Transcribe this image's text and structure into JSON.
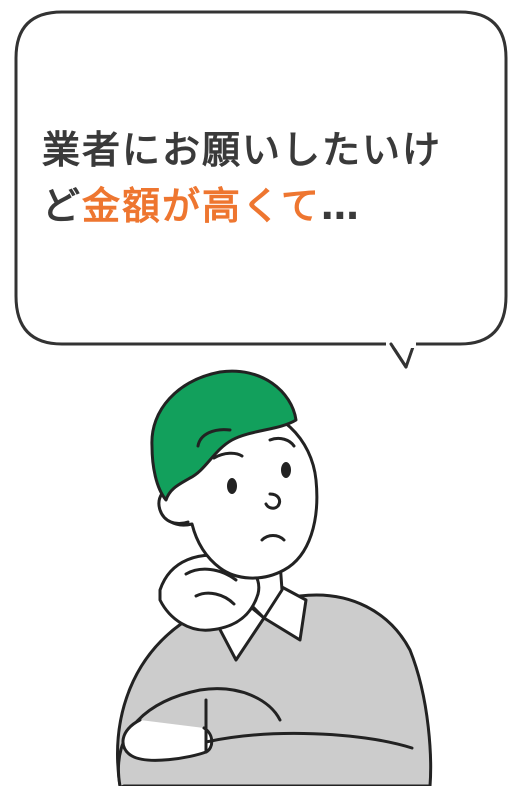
{
  "speech_bubble": {
    "line1": "業者にお願いしたいけ",
    "line2_prefix": "ど",
    "line2_highlight": "金額が高くて",
    "line2_suffix": "…"
  },
  "colors": {
    "text": "#3a3a3a",
    "highlight": "#ee7630",
    "hair": "#12a05c",
    "sweater": "#cccccc",
    "outline": "#222222"
  },
  "icons": {
    "character": "thinking-man-illustration"
  }
}
